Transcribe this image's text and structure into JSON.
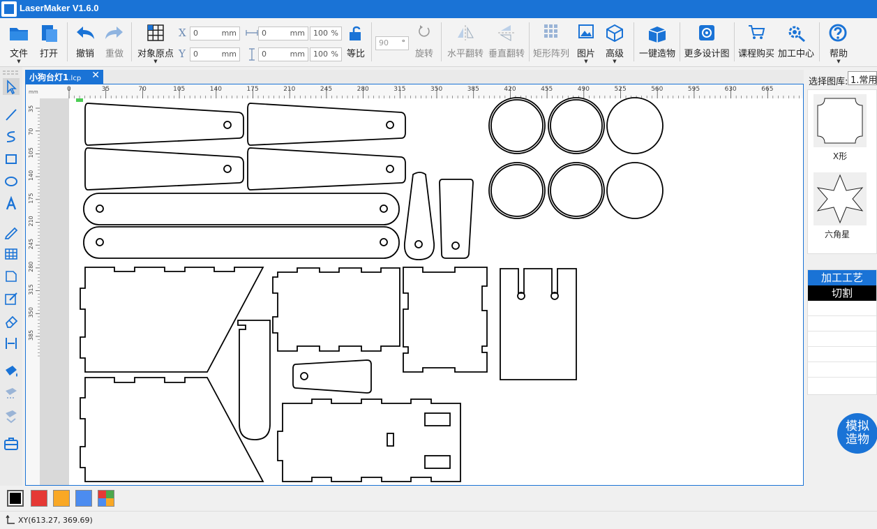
{
  "app": {
    "title": "LaserMaker V1.6.0"
  },
  "toolbar": {
    "file": "文件",
    "open": "打开",
    "undo": "撤销",
    "redo": "重做",
    "origin": "对象原点",
    "x_label": "X",
    "y_label": "Y",
    "x_value": "0",
    "y_value": "0",
    "unit": "mm",
    "w_value": "0",
    "h_value": "0",
    "w_pct": "100",
    "h_pct": "100",
    "pct_unit": "%",
    "ratio": "等比",
    "rotate_value": "90",
    "rotate_unit": "°",
    "rotate": "旋转",
    "hflip": "水平翻转",
    "vflip": "垂直翻转",
    "array": "矩形阵列",
    "image": "图片",
    "advanced": "高级",
    "one_click": "一键造物",
    "more_designs": "更多设计图",
    "course": "课程购买",
    "center": "加工中心",
    "help": "帮助"
  },
  "tab": {
    "name": "小狗台灯1",
    "ext": ".lcp",
    "close": "✕"
  },
  "ruler": {
    "unit": "mm",
    "h_ticks": [
      "0",
      "35",
      "70",
      "105",
      "140",
      "175",
      "210",
      "245",
      "280",
      "315",
      "350",
      "385",
      "420",
      "455",
      "490",
      "525",
      "560",
      "595",
      "630",
      "665"
    ],
    "v_ticks": [
      "35",
      "70",
      "105",
      "140",
      "175",
      "210",
      "245",
      "280",
      "315",
      "350",
      "385"
    ]
  },
  "library": {
    "label": "选择图库:",
    "selected": "1.常用",
    "items": [
      {
        "name": "X形",
        "icon": "x-shape-icon"
      },
      {
        "name": "六角星",
        "icon": "hexagram-icon"
      }
    ]
  },
  "process": {
    "header": "加工工艺",
    "items": [
      "切割"
    ]
  },
  "simulate": {
    "line1": "模拟",
    "line2": "造物"
  },
  "colors": [
    "#000000",
    "#e53935",
    "#f9a825",
    "#4c8cf0",
    "multi"
  ],
  "status": {
    "xy": "XY(613.27, 369.69)"
  }
}
